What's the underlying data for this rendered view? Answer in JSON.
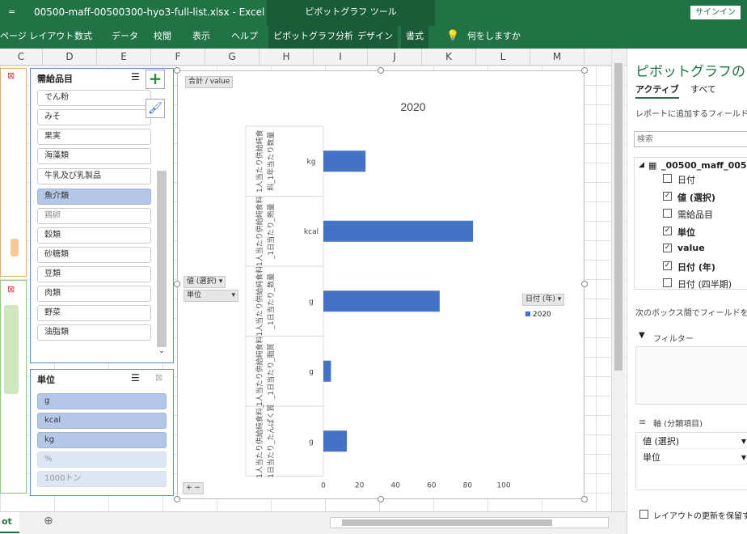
{
  "window": {
    "title": "00500-maff-00500300-hyo3-full-list.xlsx  -  Excel",
    "context_tool": "ピボットグラフ ツール",
    "signin": "サインイン",
    "qat": "="
  },
  "ribbon": {
    "tabs": [
      "ページ レイアウト",
      "数式",
      "データ",
      "校閲",
      "表示",
      "ヘルプ",
      "ピボットグラフ分析",
      "デザイン",
      "書式"
    ],
    "tell_me": "何をしますか"
  },
  "columns": [
    "C",
    "D",
    "E",
    "F",
    "G",
    "H",
    "I",
    "J",
    "K",
    "L",
    "M"
  ],
  "slicer_supply": {
    "title": "需給品目",
    "items": [
      "でん粉",
      "みそ",
      "果実",
      "海藻類",
      "牛乳及び乳製品",
      "魚介類",
      "鶏卵",
      "穀類",
      "砂糖類",
      "豆類",
      "肉類",
      "野菜",
      "油脂類"
    ],
    "selected": "魚介類",
    "dim": "鶏卵"
  },
  "slicer_unit": {
    "title": "単位",
    "items": [
      "g",
      "kcal",
      "kg",
      "%",
      "1000トン"
    ],
    "selected": [
      "g",
      "kcal",
      "kg"
    ]
  },
  "chart": {
    "value_button": "合計 / value",
    "axis_button_1": "値 (選択)",
    "axis_button_2": "単位",
    "legend_button": "日付 (年)",
    "legend_entry": "2020",
    "series_color": "#4472c4"
  },
  "chart_data": {
    "type": "bar",
    "title": "2020",
    "categories": [
      "1人当たり供給純食料_1年当たり数量|kg",
      "1人当たり供給純食料_1日当たり_熱量|kcal",
      "1人当たり供給純食料_1日当たり_数量|g",
      "1人当たり供給純食料_1日当たり_脂質|g",
      "1人当たり供給純食料_1日当たり_たんぱく質|g"
    ],
    "category_labels": [
      "1人当たり供給純食料_1年当たり数量",
      "1人当たり供給純食料_1日当たり_熱量",
      "1人当たり供給純食料_1日当たり_数量",
      "1人当たり供給純食料_1日当たり_脂質",
      "1人当たり供給純食料_1日当たり_たんぱく質"
    ],
    "units": [
      "kg",
      "kcal",
      "g",
      "g",
      "g"
    ],
    "series": [
      {
        "name": "2020",
        "values": [
          23.4,
          83.0,
          64.5,
          4.2,
          13.0
        ]
      }
    ],
    "xlim": [
      0,
      100
    ],
    "xticks": [
      "0",
      "20",
      "40",
      "60",
      "80",
      "100"
    ],
    "legend": "right"
  },
  "taskpane": {
    "title": "ピボットグラフのフィ",
    "tab_active": "アクティブ",
    "tab_all": "すべて",
    "instruction": "レポートに追加するフィールドを選",
    "search_placeholder": "検索",
    "table_name": "_00500_maff_005",
    "fields": [
      {
        "label": "日付",
        "checked": false,
        "bold": false
      },
      {
        "label": "値 (選択)",
        "checked": true,
        "bold": true
      },
      {
        "label": "需給品目",
        "checked": false,
        "bold": false
      },
      {
        "label": "単位",
        "checked": true,
        "bold": true
      },
      {
        "label": "value",
        "checked": true,
        "bold": true
      },
      {
        "label": "日付 (年)",
        "checked": true,
        "bold": true
      },
      {
        "label": "日付 (四半期)",
        "checked": false,
        "bold": false
      }
    ],
    "drag_text": "次のボックス間でフィールドをドラ",
    "filter_label": "フィルター",
    "axis_label": "軸 (分類項目)",
    "axis_items": [
      "値 (選択)",
      "単位"
    ],
    "defer_label": "レイアウトの更新を保留する"
  },
  "statusbar": {
    "sheet_tab": "ot"
  }
}
